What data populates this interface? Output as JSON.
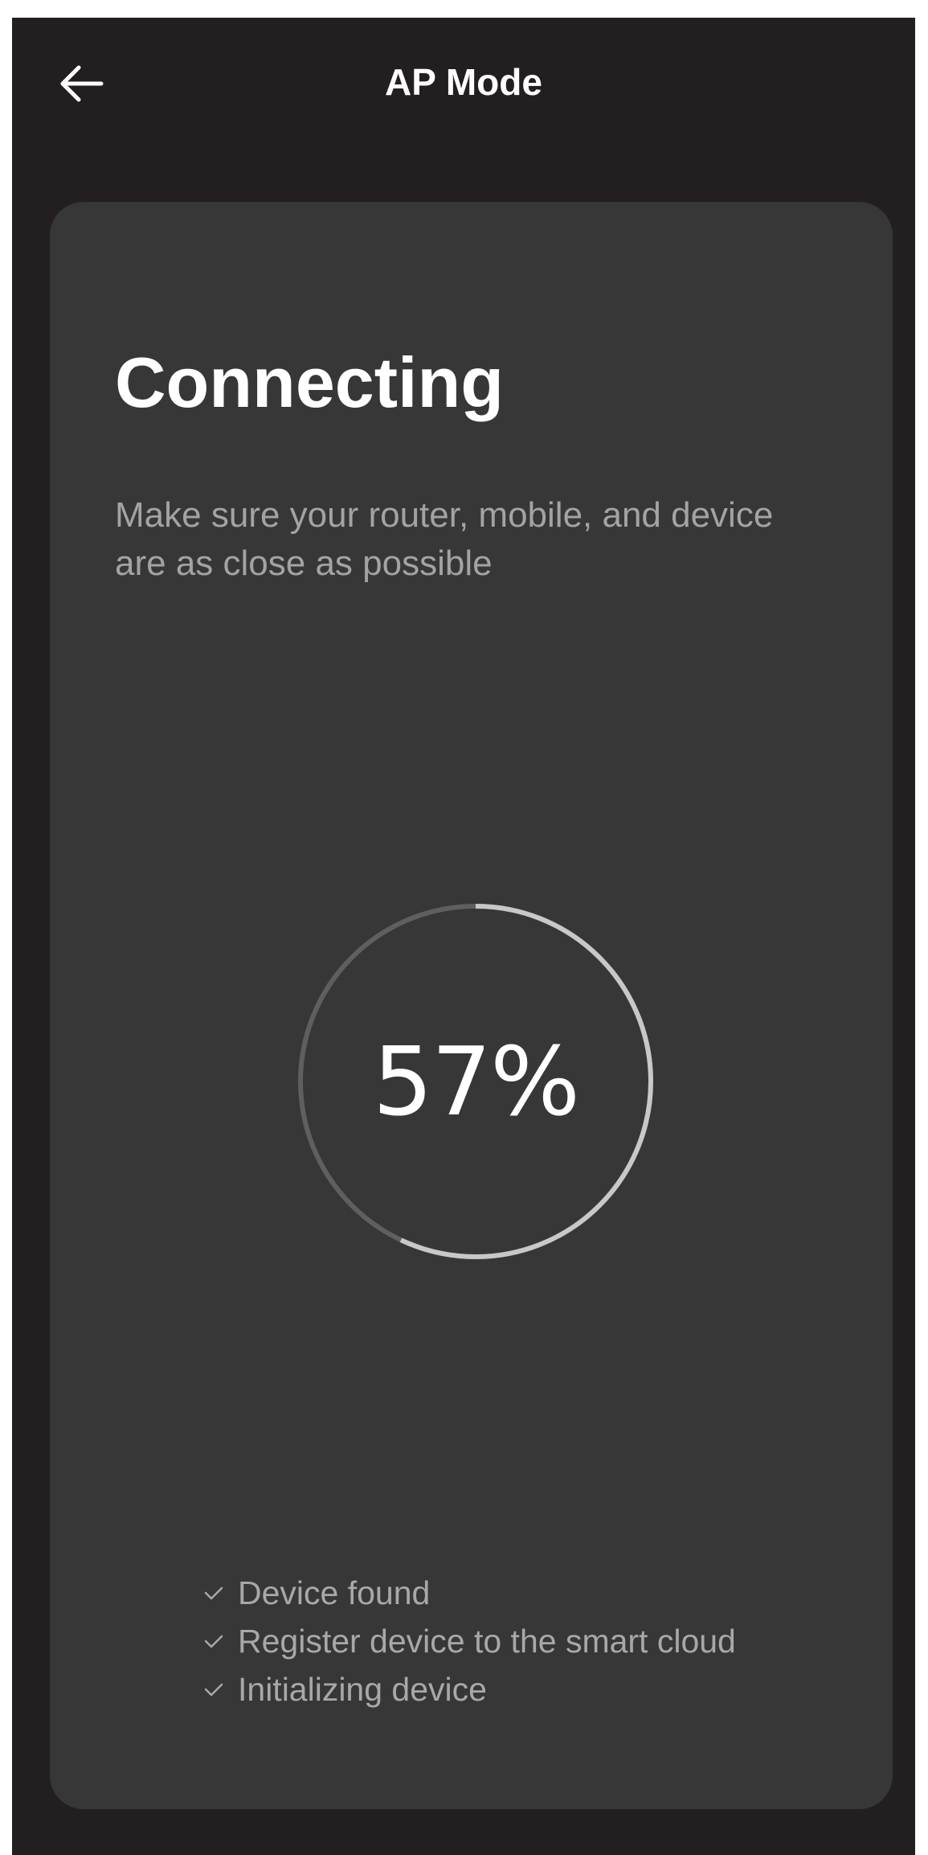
{
  "header": {
    "title": "AP Mode"
  },
  "card": {
    "title": "Connecting",
    "description": "Make sure your router, mobile, and device are as close as possible"
  },
  "progress": {
    "value": 57,
    "label": "57%"
  },
  "steps": [
    {
      "label": "Device found",
      "icon": "check-icon"
    },
    {
      "label": "Register device to the smart cloud",
      "icon": "check-icon"
    },
    {
      "label": "Initializing device",
      "icon": "check-icon"
    }
  ],
  "colors": {
    "background": "#231f20",
    "card": "#373737",
    "ring_track": "#5f5f5f",
    "ring_progress": "#c8c8c8",
    "text_primary": "#ffffff",
    "text_secondary": "#a3a3a3"
  }
}
